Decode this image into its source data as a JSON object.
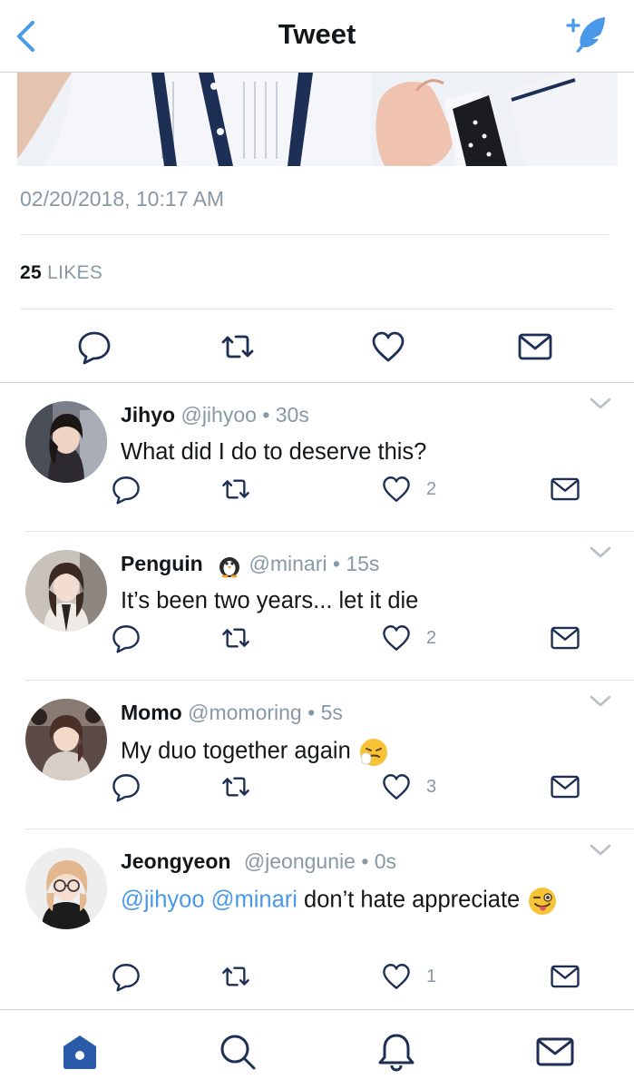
{
  "header": {
    "title": "Tweet",
    "back_icon": "chevron-left-icon",
    "compose_icon": "compose-tweet-icon",
    "accent": "#4a99e9"
  },
  "tweet": {
    "timestamp": "02/20/2018, 10:17 AM",
    "likes_count": "25",
    "likes_label": "LIKES"
  },
  "actions": [
    "reply-icon",
    "retweet-icon",
    "like-icon",
    "direct-message-icon"
  ],
  "replies": [
    {
      "name": "Jihyo",
      "handle": "@jihyoo",
      "separator": "•",
      "time": "30s",
      "text": "What did I do to deserve this?",
      "likes": "2"
    },
    {
      "name": "Penguin",
      "name_emoji": "penguin-emoji",
      "handle": "@minari",
      "separator": "•",
      "time": "15s",
      "text": "It’s been two years... let it die",
      "likes": "2"
    },
    {
      "name": "Momo",
      "handle": "@momoring",
      "separator": "•",
      "time": "5s",
      "text": "My duo together again",
      "text_emoji": "sneezing-face-emoji",
      "likes": "3"
    },
    {
      "name": "Jeongyeon",
      "handle": "@jeongunie",
      "separator": "•",
      "time": "0s",
      "mention1": "@jihyoo",
      "mention2": "@minari",
      "text": "don’t hate appreciate",
      "text_emoji": "winking-tongue-emoji",
      "likes": "1"
    }
  ],
  "tabbar": [
    "home-icon",
    "search-icon",
    "notifications-icon",
    "messages-icon"
  ],
  "colors": {
    "text": "#14171a",
    "muted": "#8899a6",
    "link": "#4a99e9",
    "divider": "#dfe3e8",
    "home_active": "#2a5aa8"
  }
}
